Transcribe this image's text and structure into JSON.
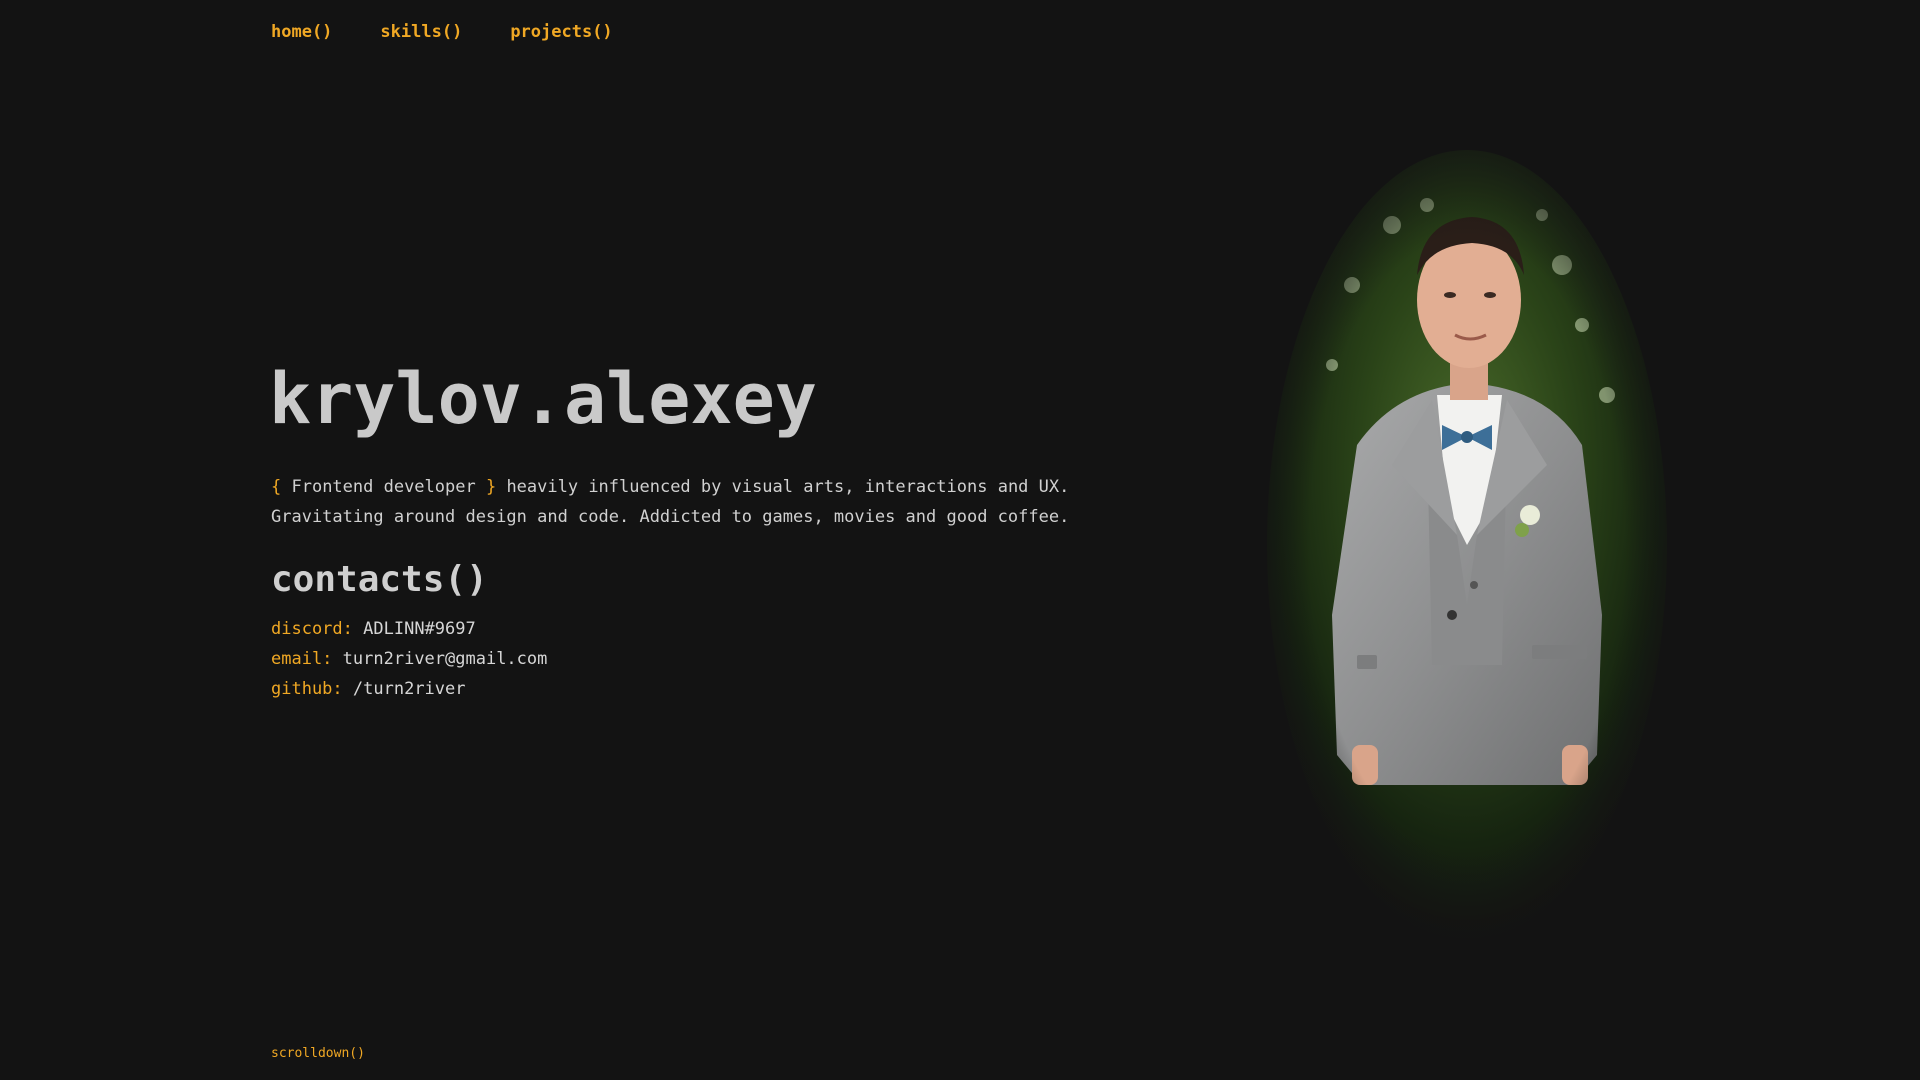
{
  "nav": {
    "items": [
      "home()",
      "skills()",
      "projects()"
    ]
  },
  "hero": {
    "name": "krylov.alexey",
    "brace_open": "{",
    "role": " Frontend developer ",
    "brace_close": "}",
    "line1_rest": " heavily influenced by visual arts, interactions and UX.",
    "line2": "Gravitating around design and code. Addicted to games, movies and good coffee."
  },
  "contacts": {
    "title": "contacts()",
    "items": [
      {
        "key": "discord:",
        "value": "ADLINN#9697"
      },
      {
        "key": "email:",
        "value": "turn2river@gmail.com"
      },
      {
        "key": "github:",
        "value": "/turn2river"
      }
    ]
  },
  "footer": {
    "scroll": "scrolldown()"
  },
  "colors": {
    "background": "#131313",
    "accent": "#f0a824",
    "text": "#d0d0d0"
  }
}
